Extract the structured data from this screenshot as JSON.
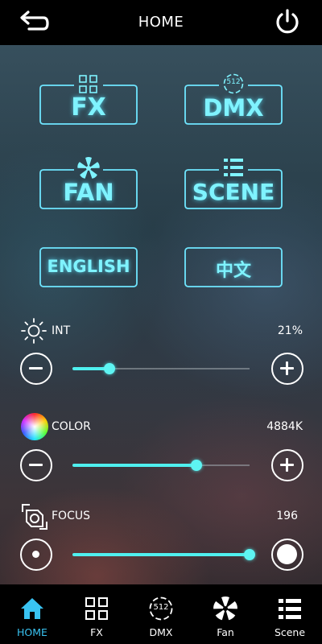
{
  "header": {
    "title": "HOME"
  },
  "tiles": {
    "fx": "FX",
    "dmx": "DMX",
    "dmx_badge": "512",
    "fan": "FAN",
    "scene": "SCENE",
    "english": "ENGLISH",
    "chinese": "中文"
  },
  "controls": {
    "int": {
      "label": "INT",
      "value": "21%",
      "level": 0.21
    },
    "color": {
      "label": "COLOR",
      "value": "4884K",
      "level": 0.7
    },
    "focus": {
      "label": "FOCUS",
      "value": "196",
      "level": 1.0
    }
  },
  "nav": {
    "items": [
      {
        "label": "HOME",
        "icon": "home-icon",
        "active": true
      },
      {
        "label": "FX",
        "icon": "grid-icon",
        "active": false
      },
      {
        "label": "DMX",
        "icon": "dmx-512-icon",
        "active": false
      },
      {
        "label": "Fan",
        "icon": "fan-icon",
        "active": false
      },
      {
        "label": "Scene",
        "icon": "list-icon",
        "active": false
      }
    ],
    "dmx_badge": "512"
  },
  "colors": {
    "accent": "#4ff0ef",
    "tile_text": "#7ff3ff",
    "nav_active": "#39c3f2"
  }
}
